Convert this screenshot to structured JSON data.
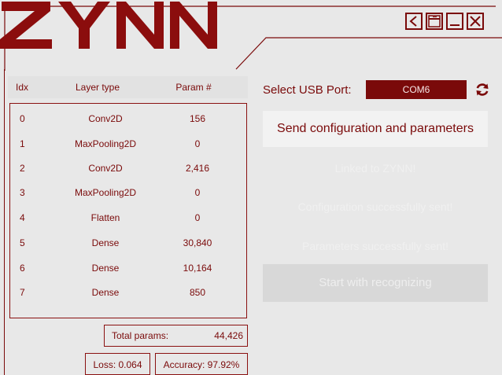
{
  "app": {
    "logo_text": "ZYNN",
    "accent": "#7a0a0a"
  },
  "window_controls": [
    {
      "name": "back-icon"
    },
    {
      "name": "maximize-icon"
    },
    {
      "name": "minimize-icon"
    },
    {
      "name": "close-icon"
    }
  ],
  "table": {
    "headers": {
      "idx": "Idx",
      "type": "Layer type",
      "param": "Param #"
    },
    "rows": [
      {
        "idx": "0",
        "type": "Conv2D",
        "param": "156"
      },
      {
        "idx": "1",
        "type": "MaxPooling2D",
        "param": "0"
      },
      {
        "idx": "2",
        "type": "Conv2D",
        "param": "2,416"
      },
      {
        "idx": "3",
        "type": "MaxPooling2D",
        "param": "0"
      },
      {
        "idx": "4",
        "type": "Flatten",
        "param": "0"
      },
      {
        "idx": "5",
        "type": "Dense",
        "param": "30,840"
      },
      {
        "idx": "6",
        "type": "Dense",
        "param": "10,164"
      },
      {
        "idx": "7",
        "type": "Dense",
        "param": "850"
      }
    ]
  },
  "stats": {
    "total_label": "Total params:",
    "total_value": "44,426",
    "loss": "Loss: 0.064",
    "accuracy": "Accuracy: 97.92%"
  },
  "usb": {
    "label": "Select USB Port:",
    "selected": "COM6"
  },
  "actions": {
    "send_label": "Send configuration and parameters",
    "linked_status": "Linked to ZYNN!",
    "config_status": "Configuration successfully sent!",
    "params_status": "Parameters successfully sent!",
    "start_label": "Start with recognizing"
  }
}
